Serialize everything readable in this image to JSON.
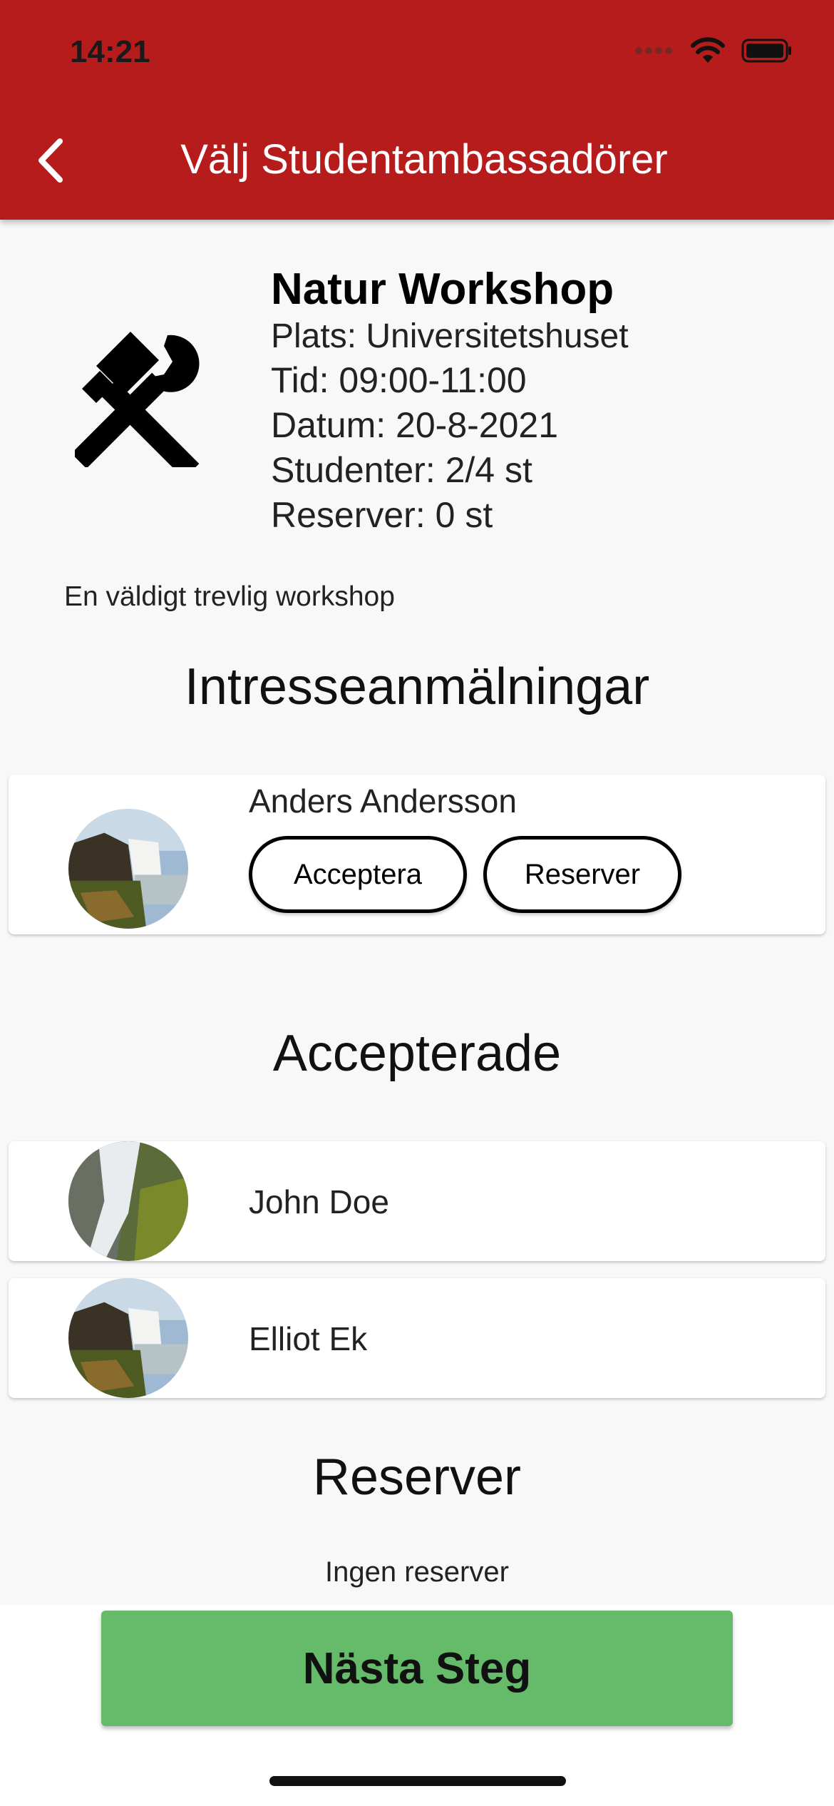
{
  "status_bar": {
    "time": "14:21"
  },
  "appbar": {
    "title": "Välj Studentambassadörer"
  },
  "workshop": {
    "title": "Natur Workshop",
    "plats": "Plats: Universitetshuset",
    "tid": "Tid: 09:00-11:00",
    "datum": "Datum: 20-8-2021",
    "studenter": "Studenter: 2/4 st",
    "reserver": "Reserver: 0 st",
    "description": "En väldigt trevlig workshop",
    "icon": "tools-icon"
  },
  "sections": {
    "interests": {
      "title": "Intresseanmälningar",
      "items": [
        {
          "name": "Anders Andersson",
          "accept_label": "Acceptera",
          "reserve_label": "Reserver"
        }
      ]
    },
    "accepted": {
      "title": "Accepterade",
      "items": [
        {
          "name": "John Doe"
        },
        {
          "name": "Elliot Ek"
        }
      ]
    },
    "reserves": {
      "title": "Reserver",
      "empty_text": "Ingen reserver"
    }
  },
  "next_button": {
    "label": "Nästa Steg"
  },
  "colors": {
    "appbar": "#b71c1c",
    "next_button": "#66bb6a",
    "background": "#f8f8f8"
  }
}
